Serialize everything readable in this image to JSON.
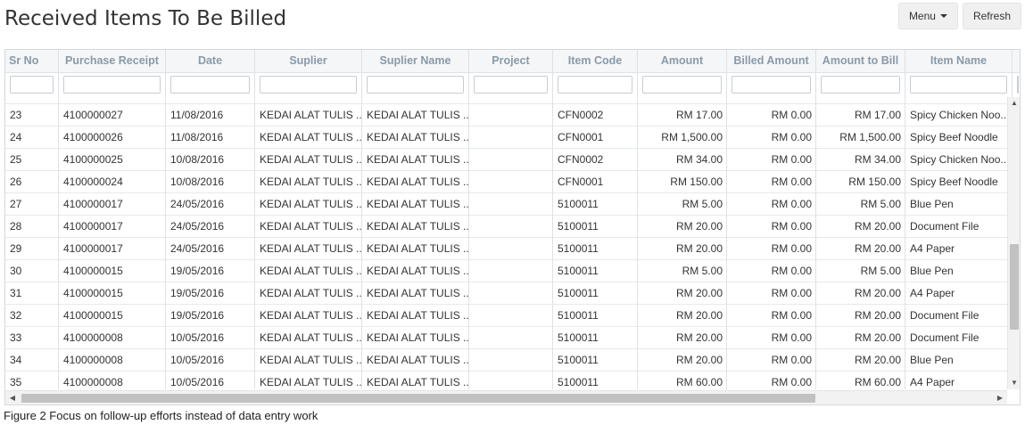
{
  "page": {
    "title": "Received Items To Be Billed"
  },
  "toolbar": {
    "menu_label": "Menu",
    "refresh_label": "Refresh"
  },
  "table": {
    "columns": [
      "Sr No",
      "Purchase Receipt",
      "Date",
      "Suplier",
      "Suplier Name",
      "Project",
      "Item Code",
      "Amount",
      "Billed Amount",
      "Amount to Bill",
      "Item Name"
    ],
    "rows": [
      [
        "23",
        "4100000027",
        "11/08/2016",
        "KEDAI ALAT TULIS ...",
        "KEDAI ALAT TULIS ...",
        "",
        "CFN0002",
        "RM 17.00",
        "RM 0.00",
        "RM 17.00",
        "Spicy Chicken Noo..."
      ],
      [
        "24",
        "4100000026",
        "11/08/2016",
        "KEDAI ALAT TULIS ...",
        "KEDAI ALAT TULIS ...",
        "",
        "CFN0001",
        "RM 1,500.00",
        "RM 0.00",
        "RM 1,500.00",
        "Spicy Beef Noodle"
      ],
      [
        "25",
        "4100000025",
        "10/08/2016",
        "KEDAI ALAT TULIS ...",
        "KEDAI ALAT TULIS ...",
        "",
        "CFN0002",
        "RM 34.00",
        "RM 0.00",
        "RM 34.00",
        "Spicy Chicken Noo..."
      ],
      [
        "26",
        "4100000024",
        "10/08/2016",
        "KEDAI ALAT TULIS ...",
        "KEDAI ALAT TULIS ...",
        "",
        "CFN0001",
        "RM 150.00",
        "RM 0.00",
        "RM 150.00",
        "Spicy Beef Noodle"
      ],
      [
        "27",
        "4100000017",
        "24/05/2016",
        "KEDAI ALAT TULIS ...",
        "KEDAI ALAT TULIS ...",
        "",
        "5100011",
        "RM 5.00",
        "RM 0.00",
        "RM 5.00",
        "Blue Pen"
      ],
      [
        "28",
        "4100000017",
        "24/05/2016",
        "KEDAI ALAT TULIS ...",
        "KEDAI ALAT TULIS ...",
        "",
        "5100011",
        "RM 20.00",
        "RM 0.00",
        "RM 20.00",
        "Document File"
      ],
      [
        "29",
        "4100000017",
        "24/05/2016",
        "KEDAI ALAT TULIS ...",
        "KEDAI ALAT TULIS ...",
        "",
        "5100011",
        "RM 20.00",
        "RM 0.00",
        "RM 20.00",
        "A4 Paper"
      ],
      [
        "30",
        "4100000015",
        "19/05/2016",
        "KEDAI ALAT TULIS ...",
        "KEDAI ALAT TULIS ...",
        "",
        "5100011",
        "RM 5.00",
        "RM 0.00",
        "RM 5.00",
        "Blue Pen"
      ],
      [
        "31",
        "4100000015",
        "19/05/2016",
        "KEDAI ALAT TULIS ...",
        "KEDAI ALAT TULIS ...",
        "",
        "5100011",
        "RM 20.00",
        "RM 0.00",
        "RM 20.00",
        "A4 Paper"
      ],
      [
        "32",
        "4100000015",
        "19/05/2016",
        "KEDAI ALAT TULIS ...",
        "KEDAI ALAT TULIS ...",
        "",
        "5100011",
        "RM 20.00",
        "RM 0.00",
        "RM 20.00",
        "Document File"
      ],
      [
        "33",
        "4100000008",
        "10/05/2016",
        "KEDAI ALAT TULIS ...",
        "KEDAI ALAT TULIS ...",
        "",
        "5100011",
        "RM 20.00",
        "RM 0.00",
        "RM 20.00",
        "Document File"
      ],
      [
        "34",
        "4100000008",
        "10/05/2016",
        "KEDAI ALAT TULIS ...",
        "KEDAI ALAT TULIS ...",
        "",
        "5100011",
        "RM 20.00",
        "RM 0.00",
        "RM 20.00",
        "Blue Pen"
      ],
      [
        "35",
        "4100000008",
        "10/05/2016",
        "KEDAI ALAT TULIS ...",
        "KEDAI ALAT TULIS ...",
        "",
        "5100011",
        "RM 60.00",
        "RM 0.00",
        "RM 60.00",
        "A4 Paper"
      ]
    ]
  },
  "caption": "Figure 2 Focus on follow-up efforts instead of data entry work",
  "icons": {
    "menu_caret": "caret-down-icon",
    "scroll_up": "arrow-up-icon",
    "scroll_down": "arrow-down-icon",
    "scroll_left": "arrow-left-icon",
    "scroll_right": "arrow-right-icon"
  },
  "colors": {
    "header_text": "#8a9aa8",
    "grid_border": "#d4d9de",
    "button_bg": "#f0f0f0"
  }
}
